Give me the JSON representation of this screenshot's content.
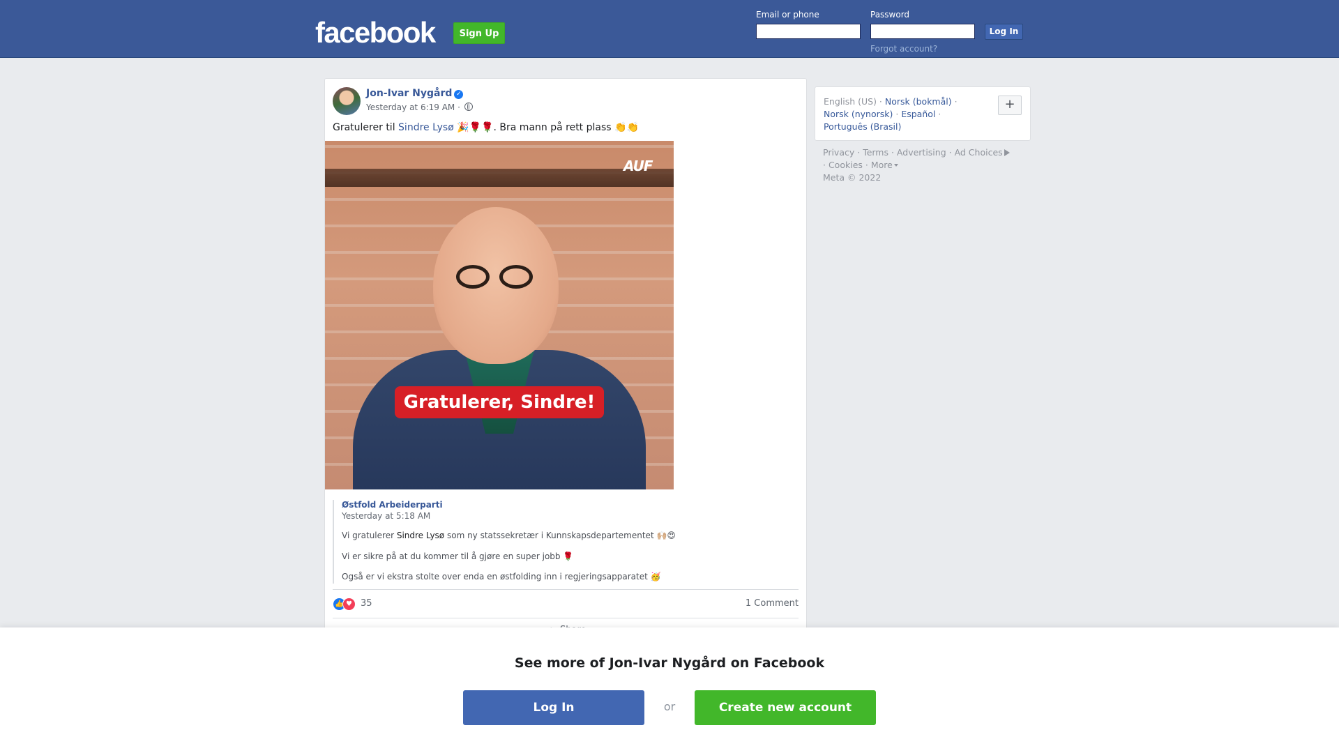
{
  "header": {
    "logo_text": "facebook",
    "signup_label": "Sign Up",
    "email_label": "Email or phone",
    "password_label": "Password",
    "login_label": "Log In",
    "forgot_label": "Forgot account?",
    "bg_color": "#3b5998"
  },
  "post": {
    "author": "Jon-Ivar Nygård",
    "time": "Yesterday at 6:19 AM",
    "text_before": "Gratulerer til ",
    "mention": "Sindre Lysø",
    "text_after": " 🎉🌹🌹. Bra mann på rett plass 👏👏",
    "image_logo": "AUF",
    "image_banner": "Gratulerer, Sindre!",
    "shared": {
      "page": "Østfold Arbeiderparti",
      "time": "Yesterday at 5:18 AM",
      "line1_before": "Vi gratulerer ",
      "line1_name": "Sindre Lysø",
      "line1_after": " som ny statssekretær i Kunnskapsdepartementet 🙌🏼😍",
      "line2": "Vi er sikre på at du kommer til å gjøre en super jobb 🌹",
      "line3": "Også er vi ekstra stolte over enda en østfolding inn i regjeringsapparatet 🥳"
    },
    "reaction_count": "35",
    "comment_count": "1 Comment",
    "share_label": "Share"
  },
  "sidebar": {
    "languages": [
      "English (US)",
      "Norsk (bokmål)",
      "Norsk (nynorsk)",
      "Español",
      "Português (Brasil)"
    ],
    "add_label": "+",
    "footer": {
      "privacy": "Privacy",
      "terms": "Terms",
      "advertising": "Advertising",
      "ad_choices": "Ad Choices",
      "cookies": "Cookies",
      "more": "More",
      "copyright": "Meta © 2022"
    }
  },
  "overlay": {
    "title": "See more of Jon-Ivar Nygård on Facebook",
    "login_label": "Log In",
    "or_label": "or",
    "create_label": "Create new account"
  }
}
